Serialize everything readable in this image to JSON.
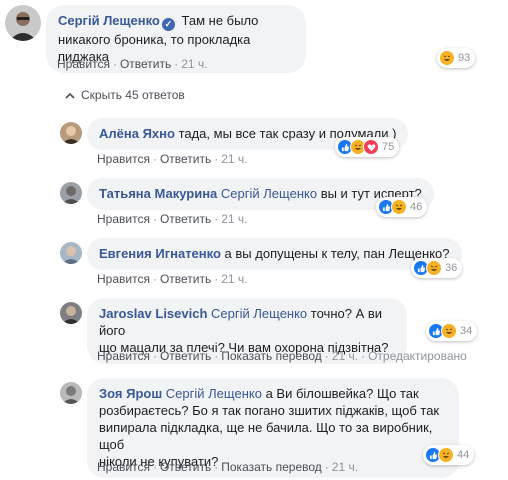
{
  "main_comment": {
    "author": "Сергій Лещенко",
    "text": "Там не было никакого броника, то прокладка пиджака",
    "actions": {
      "like": "Нравится",
      "reply": "Ответить",
      "time": "21 ч."
    },
    "reactions": {
      "types": [
        "haha"
      ],
      "count": "93"
    }
  },
  "hide_replies_label": "Скрыть 45 ответов",
  "replies": [
    {
      "author": "Алёна Яхно",
      "mention": "",
      "text": "тада, мы все так сразу и подумали )",
      "actions": {
        "like": "Нравится",
        "reply": "Ответить",
        "time": "21 ч."
      },
      "reactions": {
        "types": [
          "like",
          "haha",
          "love"
        ],
        "count": "75"
      }
    },
    {
      "author": "Татьяна Макурина",
      "mention": "Сергій Лещенко",
      "text": "вы и тут исперт?",
      "actions": {
        "like": "Нравится",
        "reply": "Ответить",
        "time": "21 ч."
      },
      "reactions": {
        "types": [
          "like",
          "haha"
        ],
        "count": "46"
      }
    },
    {
      "author": "Евгения Игнатенко",
      "mention": "",
      "text": "а вы допущены к телу, пан Лещенко?",
      "actions": {
        "like": "Нравится",
        "reply": "Ответить",
        "time": "21 ч."
      },
      "reactions": {
        "types": [
          "like",
          "haha"
        ],
        "count": "36"
      }
    },
    {
      "author": "Jaroslav Lisevich",
      "mention": "Сергій Лещенко",
      "text_line1": "точно? А ви його",
      "text_line2": "що мацали за плечі? Чи вам охорона підзвітна?",
      "actions": {
        "like": "Нравится",
        "reply": "Ответить",
        "translate": "Показать перевод",
        "time": "21 ч.",
        "edited": "Отредактировано"
      },
      "reactions": {
        "types": [
          "like",
          "haha"
        ],
        "count": "34"
      }
    },
    {
      "author": "Зоя Ярош",
      "mention": "Сергій Лещенко",
      "text_line1": "а Ви білошвейка? Що так",
      "text_line2": "розбираєтесь? Бо я так погано зшитих піджаків, щоб так",
      "text_line3": "випирала підкладка, ще не бачила. Що то за виробник, щоб",
      "text_line4": "ніколи не купувати?",
      "actions": {
        "like": "Нравится",
        "reply": "Ответить",
        "translate": "Показать перевод",
        "time": "21 ч."
      },
      "reactions": {
        "types": [
          "like",
          "haha"
        ],
        "count": "44"
      }
    }
  ],
  "colors": {
    "link": "#385898",
    "bubble": "#f2f3f5",
    "meta": "#90949c",
    "like": "#1877f2",
    "haha": "#f7b125",
    "love": "#f33e58"
  }
}
